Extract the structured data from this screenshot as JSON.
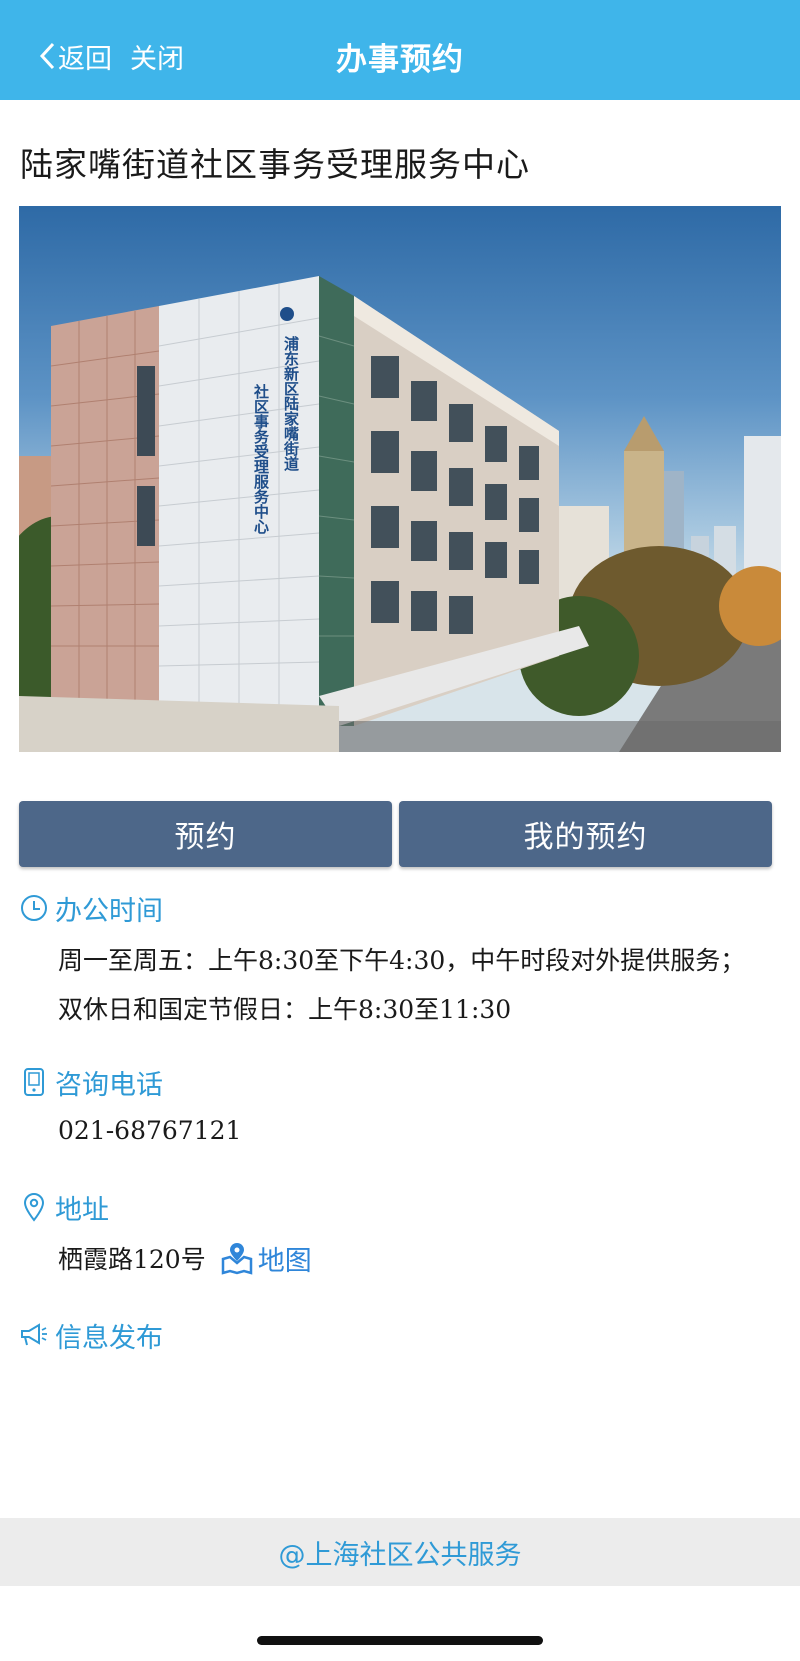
{
  "header": {
    "back_label": "返回",
    "close_label": "关闭",
    "title": "办事预约"
  },
  "center": {
    "name": "陆家嘴街道社区事务受理服务中心",
    "photo_sign": [
      "浦东新区陆家嘴街道",
      "社区事务受理服务中心"
    ]
  },
  "actions": {
    "book_label": "预约",
    "my_bookings_label": "我的预约"
  },
  "hours": {
    "heading": "办公时间",
    "lines": [
      "周一至周五：上午8:30至下午4:30，中午时段对外提供服务；",
      "双休日和国定节假日：上午8:30至11:30"
    ]
  },
  "phone": {
    "heading": "咨询电话",
    "number": "021-68767121"
  },
  "address": {
    "heading": "地址",
    "street": "栖霞路120号",
    "map_label": "地图"
  },
  "info": {
    "heading": "信息发布"
  },
  "footer": {
    "text": "@上海社区公共服务"
  },
  "colors": {
    "header_bg": "#3fb5ea",
    "button_bg": "#4d6789",
    "accent": "#2f9ad6",
    "footer_bg": "#ececec"
  }
}
